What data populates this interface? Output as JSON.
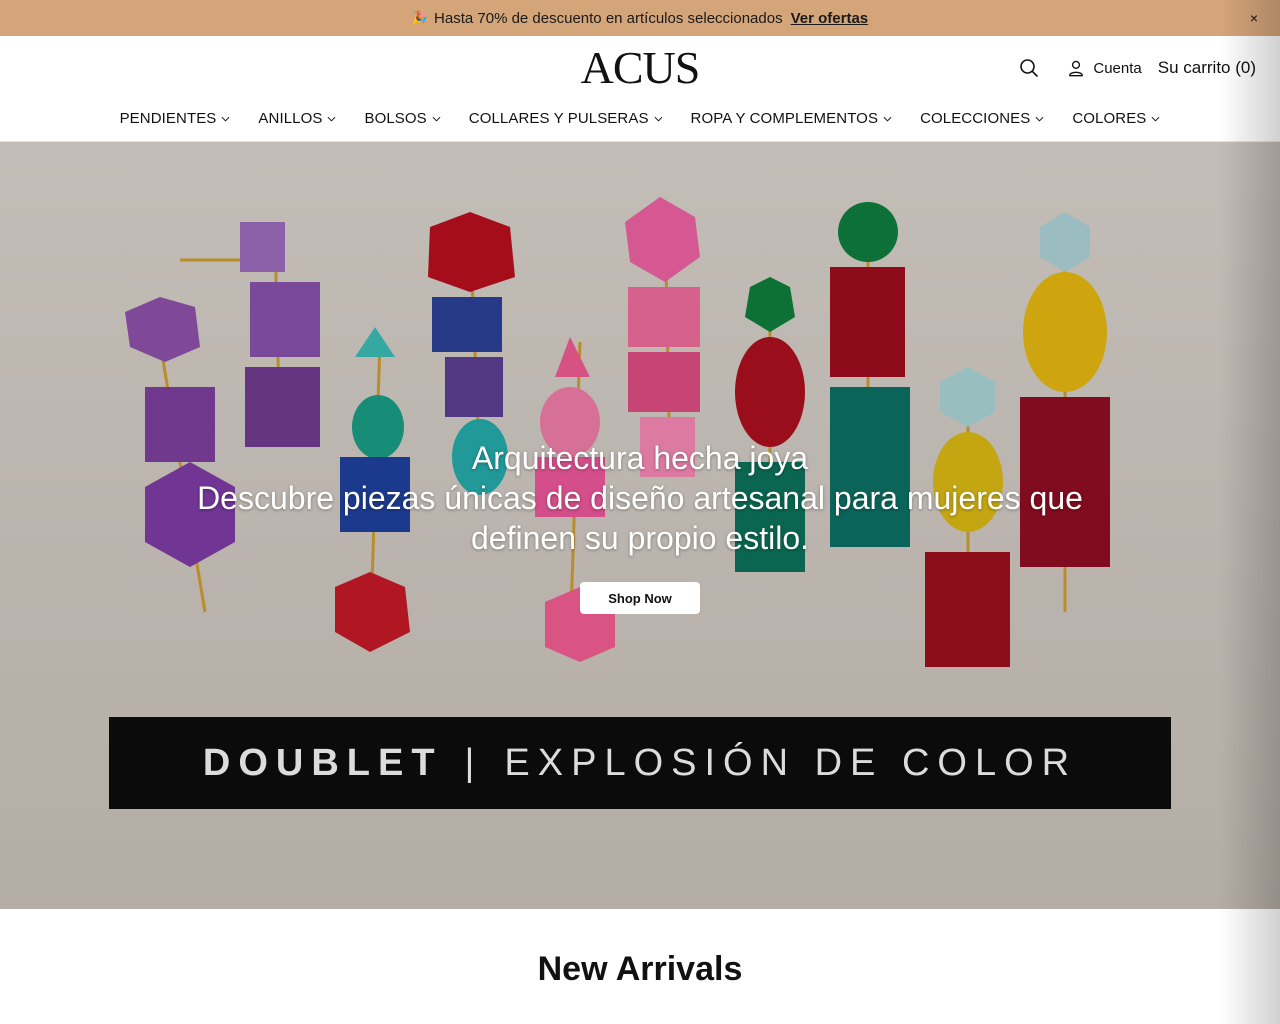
{
  "announcement": {
    "emoji": "🎉",
    "text": "Hasta 70% de descuento en artículos seleccionados",
    "link": "Ver ofertas",
    "close": "×"
  },
  "header": {
    "logo": "ACUS",
    "account_label": "Cuenta",
    "cart_label": "Su carrito (0)"
  },
  "nav": {
    "items": [
      {
        "label": "PENDIENTES"
      },
      {
        "label": "ANILLOS"
      },
      {
        "label": "BOLSOS"
      },
      {
        "label": "COLLARES Y PULSERAS"
      },
      {
        "label": "ROPA Y COMPLEMENTOS"
      },
      {
        "label": "COLECCIONES"
      },
      {
        "label": "COLORES"
      }
    ]
  },
  "hero": {
    "title": "Arquitectura hecha joya",
    "subtitle": "Descubre piezas únicas de diseño artesanal para mujeres que definen su propio estilo.",
    "button": "Shop Now",
    "banner_bold": "DOUBLET",
    "banner_sep": "|",
    "banner_rest": "EXPLOSIÓN DE COLOR"
  },
  "section": {
    "title": "New Arrivals"
  },
  "icons": [
    "search-icon",
    "user-icon",
    "chevron-down-icon",
    "close-icon"
  ],
  "colors": {
    "announcement_bg": "#d5a57a",
    "hero_bg": "#c9c2bb",
    "banner_bg": "#0b0b0b"
  }
}
